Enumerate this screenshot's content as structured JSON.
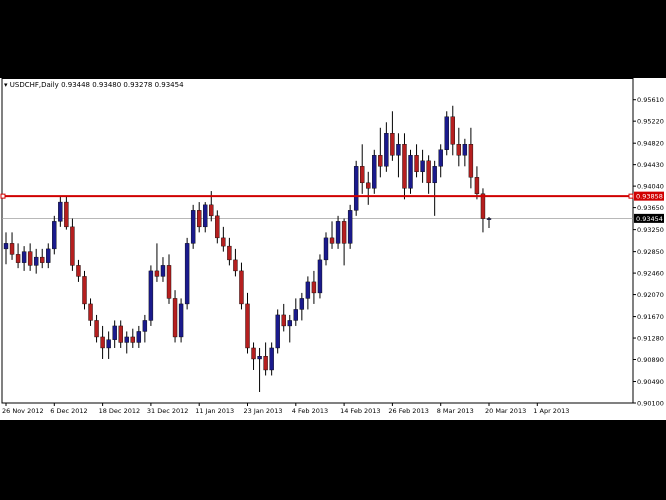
{
  "header": {
    "symbol": "USDCHF,Daily",
    "ohlc": "0.93448 0.93480 0.93278 0.93454"
  },
  "colors": {
    "background": "#ffffff",
    "bull": "#1a1a8c",
    "bear": "#b51f1f",
    "wick": "#000000",
    "hline_resistance": "#d00000",
    "price_line": "#a0a0a0",
    "axis": "#000000"
  },
  "chart_data": {
    "type": "candlestick",
    "ylim": [
      0.901,
      0.9575
    ],
    "y_ticks": [
      "0.95610",
      "0.95220",
      "0.94820",
      "0.94430",
      "0.94040",
      "0.93650",
      "0.93250",
      "0.92850",
      "0.92460",
      "0.92070",
      "0.91670",
      "0.91280",
      "0.90890",
      "0.90490",
      "0.90100"
    ],
    "x_labels": [
      "26 Nov 2012",
      "6 Dec 2012",
      "18 Dec 2012",
      "31 Dec 2012",
      "11 Jan 2013",
      "23 Jan 2013",
      "4 Feb 2013",
      "14 Feb 2013",
      "26 Feb 2013",
      "8 Mar 2013",
      "20 Mar 2013",
      "1 Apr 2013"
    ],
    "x_label_candle_index": [
      0,
      8,
      16,
      24,
      32,
      40,
      48,
      56,
      64,
      72,
      80,
      88
    ],
    "horizontal_lines": [
      {
        "value": 0.93858,
        "label": "0.93858",
        "style": "resistance"
      }
    ],
    "current_price": {
      "value": 0.93454,
      "label": "0.93454"
    },
    "candles": [
      [
        0.929,
        0.932,
        0.9262,
        0.93
      ],
      [
        0.93,
        0.932,
        0.927,
        0.928
      ],
      [
        0.928,
        0.93,
        0.9255,
        0.9265
      ],
      [
        0.9265,
        0.9295,
        0.925,
        0.9285
      ],
      [
        0.9285,
        0.93,
        0.925,
        0.926
      ],
      [
        0.926,
        0.929,
        0.9245,
        0.9275
      ],
      [
        0.9275,
        0.929,
        0.9255,
        0.9265
      ],
      [
        0.9265,
        0.93,
        0.9255,
        0.929
      ],
      [
        0.929,
        0.935,
        0.928,
        0.934
      ],
      [
        0.934,
        0.9385,
        0.933,
        0.9375
      ],
      [
        0.9375,
        0.9385,
        0.9325,
        0.933
      ],
      [
        0.933,
        0.9345,
        0.925,
        0.926
      ],
      [
        0.926,
        0.927,
        0.923,
        0.924
      ],
      [
        0.924,
        0.925,
        0.918,
        0.919
      ],
      [
        0.919,
        0.92,
        0.915,
        0.916
      ],
      [
        0.916,
        0.917,
        0.912,
        0.913
      ],
      [
        0.913,
        0.915,
        0.909,
        0.911
      ],
      [
        0.911,
        0.914,
        0.909,
        0.9125
      ],
      [
        0.9125,
        0.916,
        0.911,
        0.915
      ],
      [
        0.915,
        0.916,
        0.911,
        0.912
      ],
      [
        0.912,
        0.914,
        0.91,
        0.913
      ],
      [
        0.913,
        0.9145,
        0.911,
        0.912
      ],
      [
        0.912,
        0.915,
        0.911,
        0.914
      ],
      [
        0.914,
        0.917,
        0.912,
        0.916
      ],
      [
        0.916,
        0.926,
        0.915,
        0.925
      ],
      [
        0.925,
        0.93,
        0.923,
        0.924
      ],
      [
        0.924,
        0.9275,
        0.923,
        0.926
      ],
      [
        0.926,
        0.928,
        0.919,
        0.92
      ],
      [
        0.92,
        0.9215,
        0.912,
        0.913
      ],
      [
        0.913,
        0.92,
        0.912,
        0.919
      ],
      [
        0.919,
        0.931,
        0.918,
        0.93
      ],
      [
        0.93,
        0.937,
        0.929,
        0.936
      ],
      [
        0.936,
        0.9375,
        0.932,
        0.933
      ],
      [
        0.933,
        0.9375,
        0.932,
        0.937
      ],
      [
        0.937,
        0.9395,
        0.934,
        0.935
      ],
      [
        0.935,
        0.936,
        0.93,
        0.931
      ],
      [
        0.931,
        0.933,
        0.9285,
        0.9295
      ],
      [
        0.9295,
        0.931,
        0.926,
        0.927
      ],
      [
        0.927,
        0.929,
        0.924,
        0.925
      ],
      [
        0.925,
        0.9265,
        0.918,
        0.919
      ],
      [
        0.919,
        0.921,
        0.91,
        0.911
      ],
      [
        0.911,
        0.912,
        0.907,
        0.909
      ],
      [
        0.909,
        0.911,
        0.903,
        0.9095
      ],
      [
        0.9095,
        0.912,
        0.906,
        0.907
      ],
      [
        0.907,
        0.912,
        0.906,
        0.911
      ],
      [
        0.911,
        0.918,
        0.91,
        0.917
      ],
      [
        0.917,
        0.919,
        0.914,
        0.915
      ],
      [
        0.915,
        0.917,
        0.912,
        0.916
      ],
      [
        0.916,
        0.92,
        0.915,
        0.918
      ],
      [
        0.918,
        0.921,
        0.916,
        0.92
      ],
      [
        0.92,
        0.924,
        0.918,
        0.923
      ],
      [
        0.923,
        0.925,
        0.919,
        0.921
      ],
      [
        0.921,
        0.928,
        0.92,
        0.927
      ],
      [
        0.927,
        0.932,
        0.926,
        0.931
      ],
      [
        0.931,
        0.934,
        0.929,
        0.93
      ],
      [
        0.93,
        0.935,
        0.929,
        0.934
      ],
      [
        0.934,
        0.9345,
        0.926,
        0.93
      ],
      [
        0.93,
        0.937,
        0.929,
        0.936
      ],
      [
        0.936,
        0.945,
        0.935,
        0.944
      ],
      [
        0.944,
        0.948,
        0.939,
        0.941
      ],
      [
        0.941,
        0.943,
        0.937,
        0.94
      ],
      [
        0.94,
        0.947,
        0.939,
        0.946
      ],
      [
        0.946,
        0.951,
        0.942,
        0.944
      ],
      [
        0.944,
        0.952,
        0.943,
        0.95
      ],
      [
        0.95,
        0.954,
        0.945,
        0.946
      ],
      [
        0.946,
        0.95,
        0.942,
        0.948
      ],
      [
        0.948,
        0.95,
        0.938,
        0.94
      ],
      [
        0.94,
        0.947,
        0.939,
        0.946
      ],
      [
        0.946,
        0.948,
        0.942,
        0.943
      ],
      [
        0.943,
        0.947,
        0.941,
        0.945
      ],
      [
        0.945,
        0.946,
        0.939,
        0.941
      ],
      [
        0.941,
        0.945,
        0.935,
        0.944
      ],
      [
        0.944,
        0.948,
        0.942,
        0.947
      ],
      [
        0.947,
        0.954,
        0.946,
        0.953
      ],
      [
        0.953,
        0.955,
        0.946,
        0.948
      ],
      [
        0.948,
        0.951,
        0.944,
        0.946
      ],
      [
        0.946,
        0.949,
        0.944,
        0.948
      ],
      [
        0.948,
        0.951,
        0.94,
        0.942
      ],
      [
        0.942,
        0.944,
        0.938,
        0.939
      ],
      [
        0.939,
        0.94,
        0.932,
        0.9345
      ],
      [
        0.9345,
        0.9348,
        0.9328,
        0.9345
      ]
    ]
  }
}
